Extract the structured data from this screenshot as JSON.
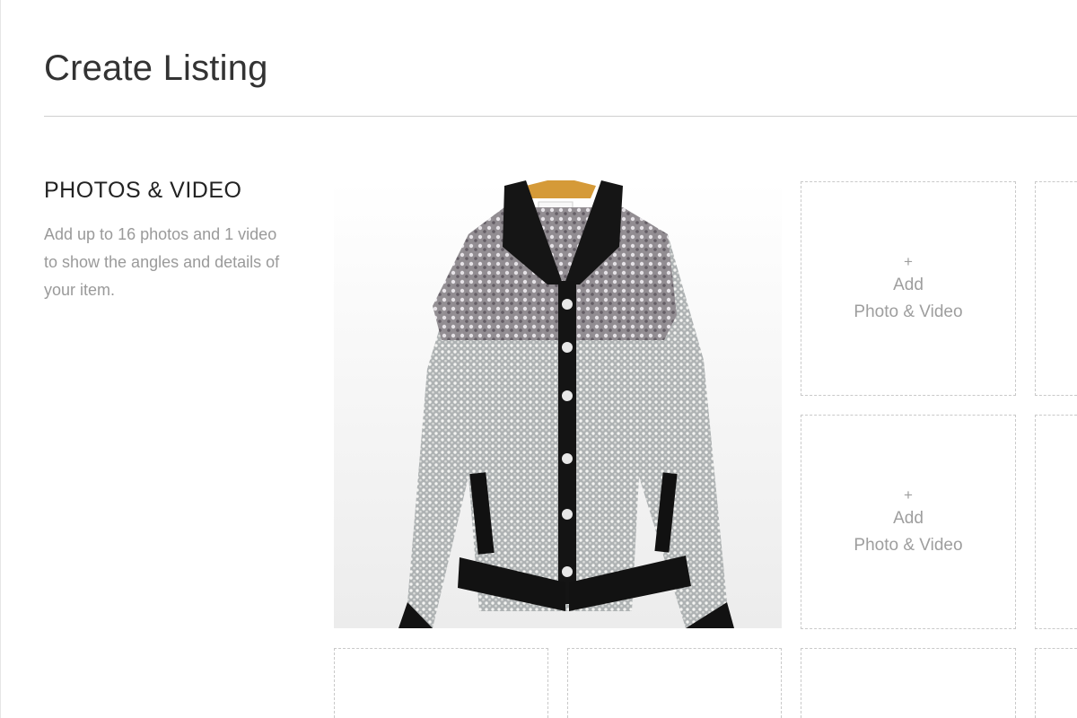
{
  "page": {
    "title": "Create Listing"
  },
  "photos_section": {
    "heading": "PHOTOS & VIDEO",
    "description": "Add up to 16 photos and 1 video to show the angles and details of your item.",
    "main_photo_alt": "Embellished jacket photo",
    "slots": [
      {
        "plus": "+",
        "add": "Add",
        "sub": "Photo & Video"
      },
      {
        "plus": "+",
        "add": "Add",
        "sub": "Photo & Video"
      }
    ]
  },
  "colors": {
    "border": "#c9c9c9",
    "placeholder_text": "#9e9e9e",
    "title_text": "#333333"
  }
}
